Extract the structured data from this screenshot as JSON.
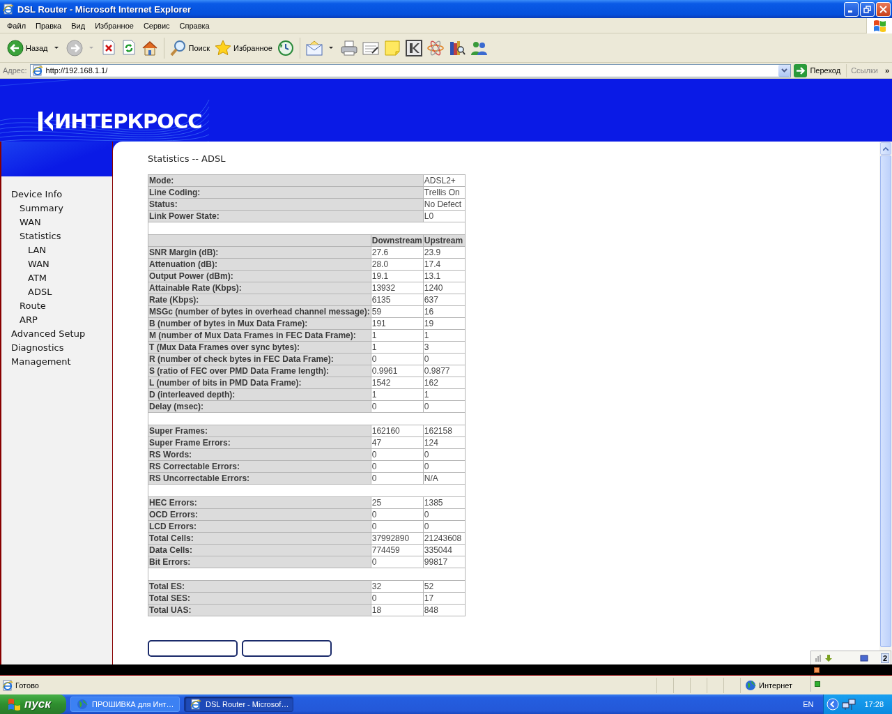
{
  "window": {
    "title": "DSL Router - Microsoft Internet Explorer"
  },
  "menu": [
    "Файл",
    "Правка",
    "Вид",
    "Избранное",
    "Сервис",
    "Справка"
  ],
  "toolbar": {
    "back": "Назад",
    "search": "Поиск",
    "favorites": "Избранное"
  },
  "address_bar": {
    "label": "Адрес:",
    "value": "http://192.168.1.1/",
    "go": "Переход",
    "links": "Ссылки",
    "more": "»"
  },
  "page": {
    "logo": "ИНТЕРКРОСС",
    "nav": [
      {
        "label": "Device Info",
        "children": [
          {
            "label": "Summary"
          },
          {
            "label": "WAN"
          },
          {
            "label": "Statistics",
            "children": [
              {
                "label": "LAN"
              },
              {
                "label": "WAN"
              },
              {
                "label": "ATM"
              },
              {
                "label": "ADSL"
              }
            ]
          },
          {
            "label": "Route"
          },
          {
            "label": "ARP"
          }
        ]
      },
      {
        "label": "Advanced Setup"
      },
      {
        "label": "Diagnostics"
      },
      {
        "label": "Management"
      }
    ],
    "title": "Statistics -- ADSL",
    "rows": [
      {
        "kind": "info",
        "label": "Mode:",
        "value": "ADSL2+"
      },
      {
        "kind": "info",
        "label": "Line Coding:",
        "value": "Trellis On"
      },
      {
        "kind": "info",
        "label": "Status:",
        "value": "No Defect"
      },
      {
        "kind": "info",
        "label": "Link Power State:",
        "value": "L0"
      },
      {
        "kind": "blank"
      },
      {
        "kind": "header",
        "downstream": "Downstream",
        "upstream": "Upstream"
      },
      {
        "kind": "stat",
        "label": "SNR Margin (dB):",
        "downstream": "27.6",
        "upstream": "23.9"
      },
      {
        "kind": "stat",
        "label": "Attenuation (dB):",
        "downstream": "28.0",
        "upstream": "17.4"
      },
      {
        "kind": "stat",
        "label": "Output Power (dBm):",
        "downstream": "19.1",
        "upstream": "13.1"
      },
      {
        "kind": "stat",
        "label": "Attainable Rate (Kbps):",
        "downstream": "13932",
        "upstream": "1240"
      },
      {
        "kind": "stat",
        "label": "Rate (Kbps):",
        "downstream": "6135",
        "upstream": "637"
      },
      {
        "kind": "stat",
        "label": "MSGc (number of bytes in overhead channel message):",
        "downstream": "59",
        "upstream": "16"
      },
      {
        "kind": "stat",
        "label": "B (number of bytes in Mux Data Frame):",
        "downstream": "191",
        "upstream": "19"
      },
      {
        "kind": "stat",
        "label": "M (number of Mux Data Frames in FEC Data Frame):",
        "downstream": "1",
        "upstream": "1"
      },
      {
        "kind": "stat",
        "label": "T (Mux Data Frames over sync bytes):",
        "downstream": "1",
        "upstream": "3"
      },
      {
        "kind": "stat",
        "label": "R (number of check bytes in FEC Data Frame):",
        "downstream": "0",
        "upstream": "0"
      },
      {
        "kind": "stat",
        "label": "S (ratio of FEC over PMD Data Frame length):",
        "downstream": "0.9961",
        "upstream": "0.9877"
      },
      {
        "kind": "stat",
        "label": "L (number of bits in PMD Data Frame):",
        "downstream": "1542",
        "upstream": "162"
      },
      {
        "kind": "stat",
        "label": "D (interleaved depth):",
        "downstream": "1",
        "upstream": "1"
      },
      {
        "kind": "stat",
        "label": "Delay (msec):",
        "downstream": "0",
        "upstream": "0"
      },
      {
        "kind": "blank"
      },
      {
        "kind": "stat",
        "label": "Super Frames:",
        "downstream": "162160",
        "upstream": "162158"
      },
      {
        "kind": "stat",
        "label": "Super Frame Errors:",
        "downstream": "47",
        "upstream": "124"
      },
      {
        "kind": "stat",
        "label": "RS Words:",
        "downstream": "0",
        "upstream": "0"
      },
      {
        "kind": "stat",
        "label": "RS Correctable Errors:",
        "downstream": "0",
        "upstream": "0"
      },
      {
        "kind": "stat",
        "label": "RS Uncorrectable Errors:",
        "downstream": "0",
        "upstream": "N/A"
      },
      {
        "kind": "blank"
      },
      {
        "kind": "stat",
        "label": "HEC Errors:",
        "downstream": "25",
        "upstream": "1385"
      },
      {
        "kind": "stat",
        "label": "OCD Errors:",
        "downstream": "0",
        "upstream": "0"
      },
      {
        "kind": "stat",
        "label": "LCD Errors:",
        "downstream": "0",
        "upstream": "0"
      },
      {
        "kind": "stat",
        "label": "Total Cells:",
        "downstream": "37992890",
        "upstream": "21243608"
      },
      {
        "kind": "stat",
        "label": "Data Cells:",
        "downstream": "774459",
        "upstream": "335044"
      },
      {
        "kind": "stat",
        "label": "Bit Errors:",
        "downstream": "0",
        "upstream": "99817"
      },
      {
        "kind": "blank"
      },
      {
        "kind": "stat",
        "label": "Total ES:",
        "downstream": "32",
        "upstream": "52"
      },
      {
        "kind": "stat",
        "label": "Total SES:",
        "downstream": "0",
        "upstream": "17"
      },
      {
        "kind": "stat",
        "label": "Total UAS:",
        "downstream": "18",
        "upstream": "848"
      }
    ]
  },
  "status_bar": {
    "text": "Готово",
    "zone": "Интернет"
  },
  "tray_popup": {
    "badge": "2"
  },
  "taskbar": {
    "start": "пуск",
    "tasks": [
      {
        "label": "ПРОШИВКА для Инт…",
        "selected": false
      },
      {
        "label": "DSL Router - Microsof…",
        "selected": true
      }
    ],
    "language": "EN",
    "clock": "17:28"
  }
}
